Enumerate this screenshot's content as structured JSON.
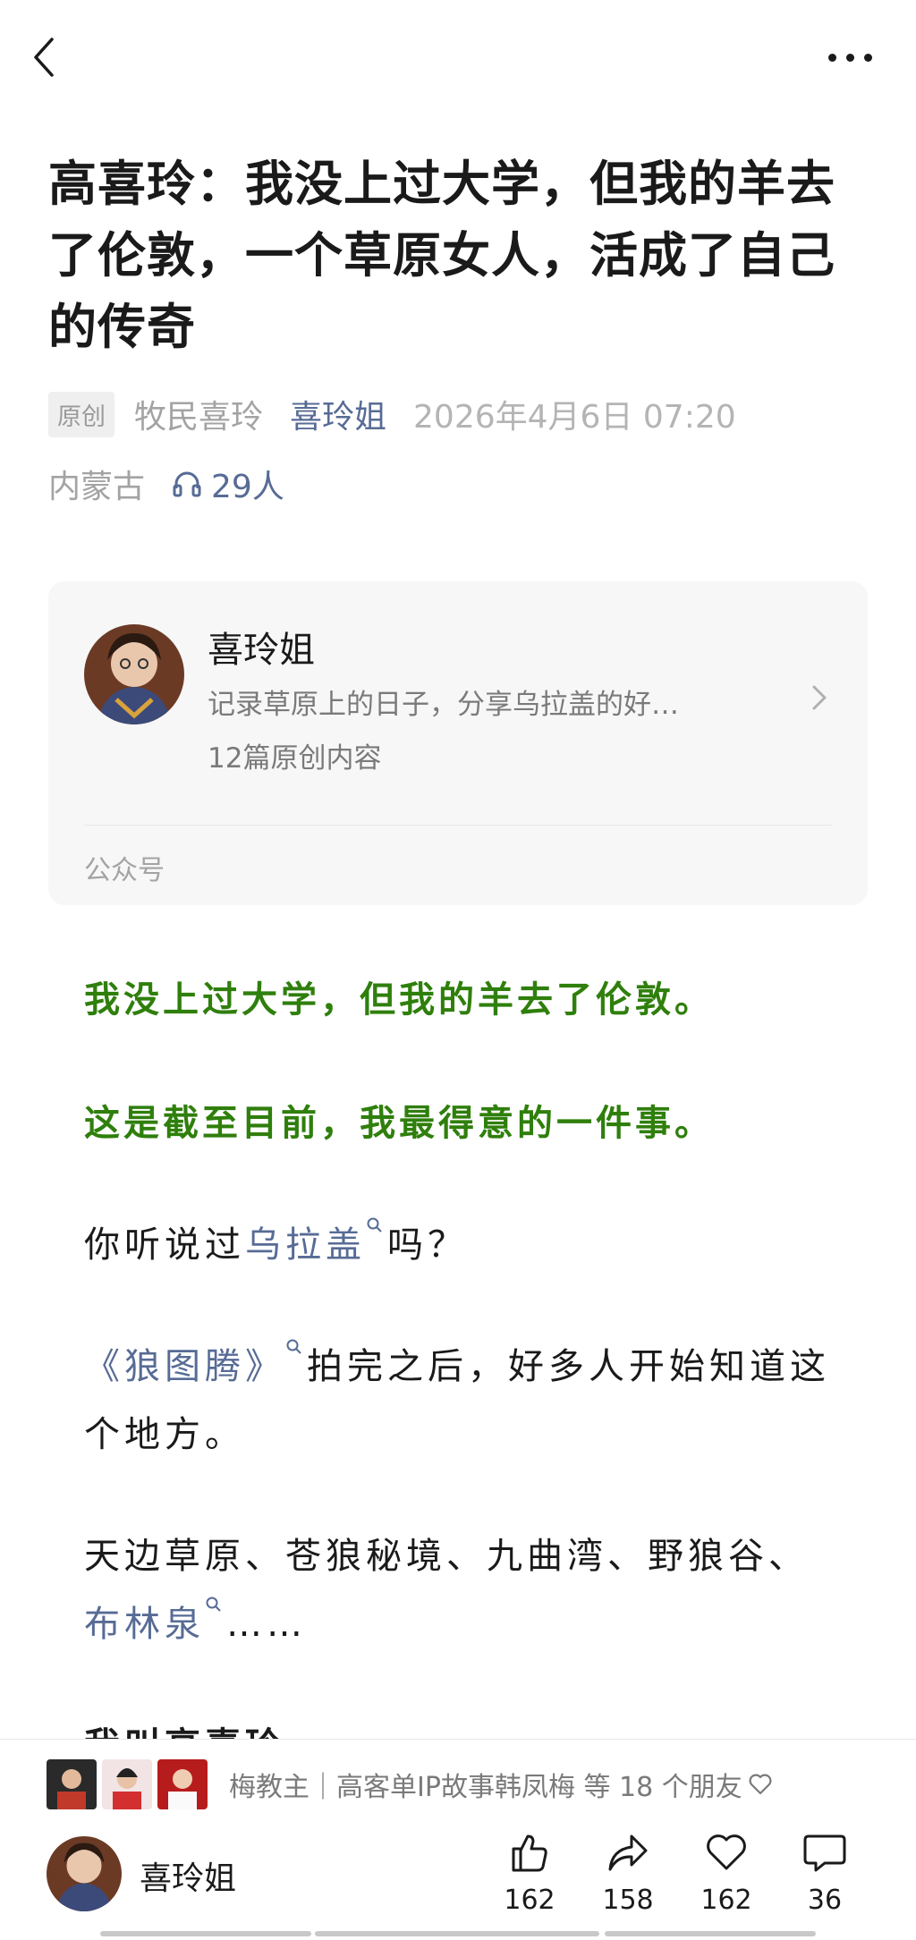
{
  "header": {
    "back_icon": "back-arrow-icon",
    "more_icon": "more-dots-icon"
  },
  "article": {
    "title": "高喜玲：我没上过大学，但我的羊去了伦敦，一个草原女人，活成了自己的传奇",
    "original_badge": "原创",
    "account": "牧民喜玲",
    "author": "喜玲姐",
    "datetime": "2026年4月6日 07:20",
    "region": "内蒙古",
    "listeners": "29人"
  },
  "account_card": {
    "name": "喜玲姐",
    "description": "记录草原上的日子，分享乌拉盖的好…",
    "post_count": "12篇原创内容",
    "type": "公众号"
  },
  "body": {
    "p1": "我没上过大学，但我的羊去了伦敦。",
    "p2": "这是截至目前，我最得意的一件事。",
    "p3_pre": "你听说过",
    "p3_link": "乌拉盖",
    "p3_post": "吗？",
    "p4_link": "《狼图腾》",
    "p4_post": "拍完之后，好多人开始知道这个地方。",
    "p5_pre": "天边草原、苍狼秘境、九曲湾、野狼谷、",
    "p5_link": "布林泉",
    "p5_post": "……",
    "p6": "我叫高喜玲"
  },
  "footer": {
    "friends_text": "梅教主｜高客单IP故事韩凤梅 等 18 个朋友",
    "publisher_name": "喜玲姐",
    "like_count": "162",
    "share_count": "158",
    "favorite_count": "162",
    "comment_count": "36"
  },
  "colors": {
    "link": "#576b95",
    "highlight_green": "#2f7f0c",
    "meta_gray": "#a3a3a3"
  }
}
